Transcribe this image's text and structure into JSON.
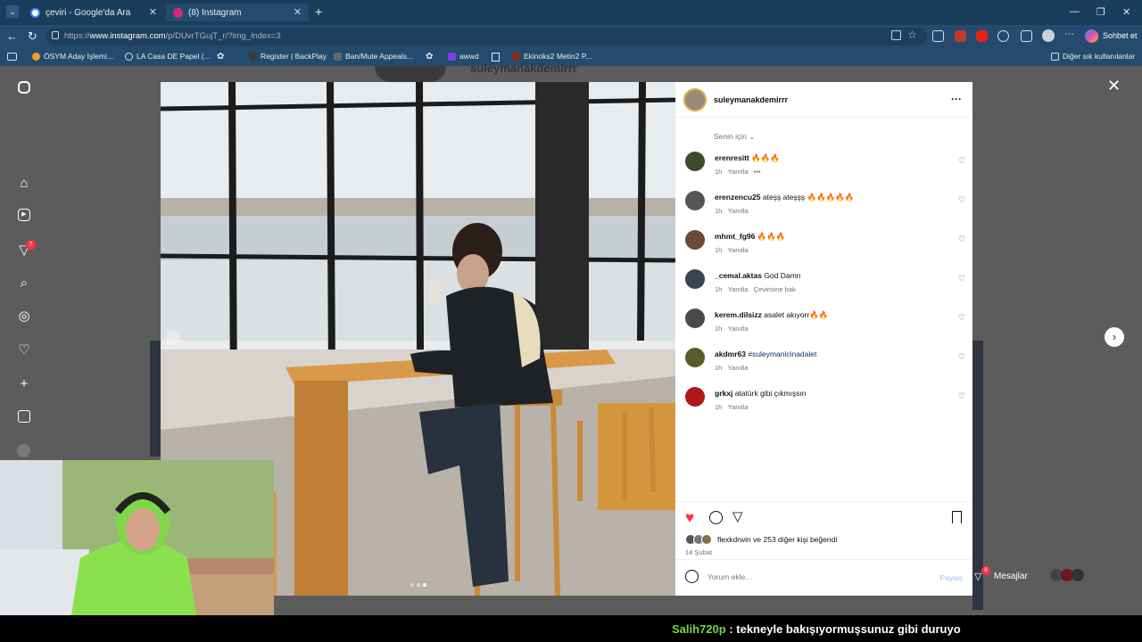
{
  "browser": {
    "tabs": [
      {
        "title": "çeviri - Google'da Ara"
      },
      {
        "title": "(8) Instagram"
      }
    ],
    "url_prefix": "https://",
    "url_host": "www.instagram.com",
    "url_path": "/p/DUvrTGujT_r/?img_index=3",
    "copilot_label": "Sohbet et",
    "bookmarks": [
      "ÖSYM Aday İşlemi...",
      "LA Casa DE Papel (...",
      "Register | BackPlay",
      "Ban/Mute Appeals...",
      "awwd",
      "Ekinoks2 Metin2 P..."
    ],
    "other_favorites": "Diğer sık kullanılanlar"
  },
  "sidebar": {
    "notification_count": "7"
  },
  "behind_text": "suleymanakdemirrr",
  "post": {
    "author": "suleymanakdemirrr",
    "more": "···",
    "filter_label": "Senin için",
    "comments": [
      {
        "user": "erenresitt",
        "text": "🔥🔥🔥",
        "time": "1h",
        "reply": "Yanıtla",
        "extra": "•••",
        "avatar_color": "#3d4a2a"
      },
      {
        "user": "erenzencu25",
        "text": "ateşş ateşşş 🔥🔥🔥🔥🔥",
        "time": "1h",
        "reply": "Yanıtla",
        "extra": "",
        "avatar_color": "#555"
      },
      {
        "user": "mhmt_fg96",
        "text": "🔥🔥🔥",
        "time": "1h",
        "reply": "Yanıtla",
        "extra": "",
        "avatar_color": "#6b4a3a"
      },
      {
        "user": "_cemal.aktas",
        "text": "God Damn",
        "time": "1h",
        "reply": "Yanıtla",
        "extra": "Çevirisine bak",
        "avatar_color": "#3b4250"
      },
      {
        "user": "kerem.dilsizz",
        "text": "asalet akıyorr🔥🔥",
        "time": "1h",
        "reply": "Yanıtla",
        "extra": "",
        "avatar_color": "#4a4a4a"
      },
      {
        "user": "akdmr63",
        "text": "#suleymanicinadalet",
        "time": "1h",
        "reply": "Yanıtla",
        "extra": "",
        "avatar_color": "#5a5a2a"
      },
      {
        "user": "grkxj",
        "text": "atatürk gibi çıkmışsın",
        "time": "1h",
        "reply": "Yanıtla",
        "extra": "",
        "avatar_color": "#b01818"
      }
    ],
    "likes_user": "flexkdrwin",
    "likes_rest": "ve 253 diğer kişi beğendi",
    "date": "14 Şubat",
    "comment_placeholder": "Yorum ekle...",
    "share_label": "Paylaş",
    "liked": true
  },
  "messages": {
    "label": "Mesajlar",
    "count": "8"
  },
  "overlay_chat": {
    "user": "Salih720p",
    "message": ": tekneyle bakışıyormuşsunuz gibi duruyo"
  },
  "colors": {
    "tabbar": "#1b3d5c",
    "chrome": "#244b6e",
    "like": "#ff3040",
    "chat_user": "#7bd23a"
  }
}
